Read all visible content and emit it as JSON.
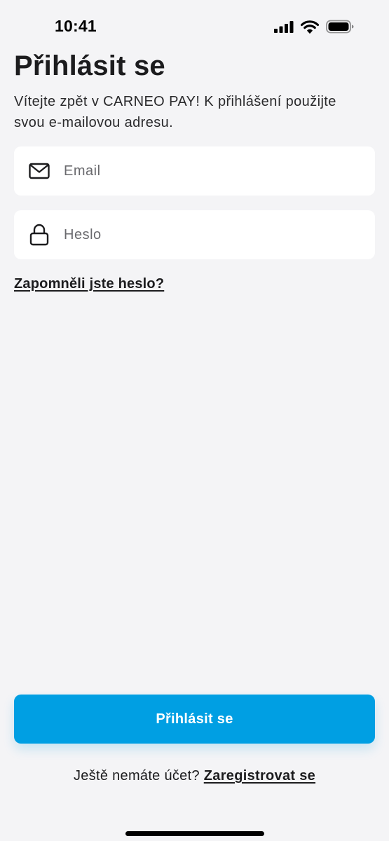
{
  "status_bar": {
    "time": "10:41",
    "icons": [
      "cellular-signal-icon",
      "wifi-icon",
      "battery-icon"
    ]
  },
  "header": {
    "title": "Přihlásit se",
    "subtitle": "Vítejte zpět v CARNEO PAY! K přihlášení použijte svou e-mailovou adresu."
  },
  "form": {
    "email": {
      "icon": "envelope-icon",
      "value": "",
      "placeholder": "Email"
    },
    "password": {
      "icon": "lock-icon",
      "value": "",
      "placeholder": "Heslo"
    },
    "forgot_label": "Zapomněli jste heslo?",
    "submit_label": "Přihlásit se"
  },
  "footer": {
    "prompt": "Ještě nemáte účet?",
    "register_label": "Zaregistrovat se"
  },
  "colors": {
    "accent": "#009fe3",
    "background": "#f4f4f6",
    "surface": "#ffffff",
    "text": "#1c1c1e"
  }
}
